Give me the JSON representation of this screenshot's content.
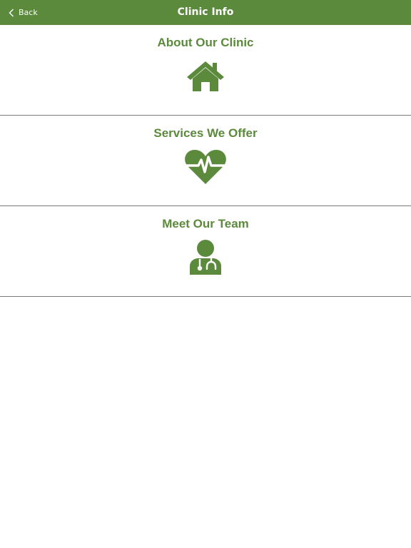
{
  "navbar": {
    "back_label": "Back",
    "title": "Clinic Info"
  },
  "menu": {
    "items": [
      {
        "label": "About Our Clinic",
        "icon": "home-icon"
      },
      {
        "label": "Services We Offer",
        "icon": "heart-pulse-icon"
      },
      {
        "label": "Meet Our Team",
        "icon": "doctor-icon"
      }
    ]
  },
  "colors": {
    "brand_green": "#5b8a3c",
    "divider": "#7a7a7a",
    "background": "#ffffff"
  }
}
